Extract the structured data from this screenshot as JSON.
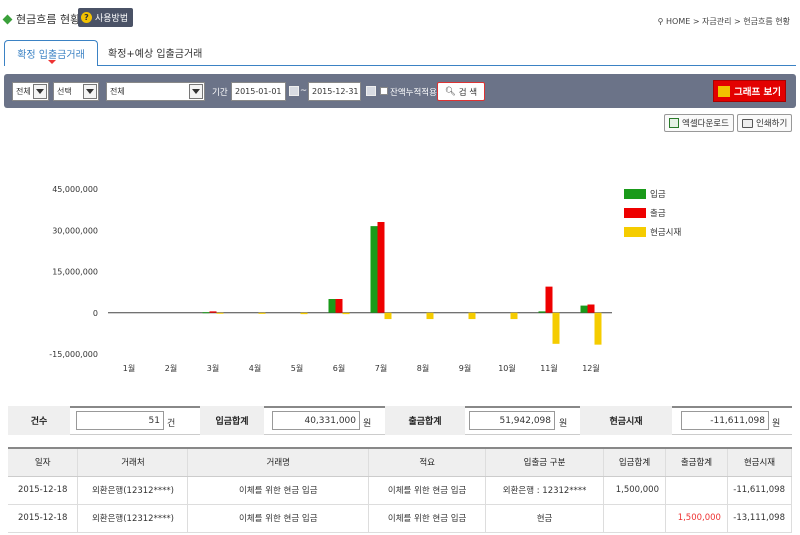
{
  "header": {
    "title": "현금흐름 현황",
    "help_label": "사용방법",
    "breadcrumb": "HOME > 자금관리 > 현금흐름 현황"
  },
  "tabs": [
    {
      "label": "확정 입출금거래"
    },
    {
      "label": "확정+예상 입출금거래"
    }
  ],
  "filters": {
    "sel1": "전체",
    "sel2": "선택",
    "sel3": "전체",
    "period_label": "기간",
    "date_from": "2015-01-01",
    "tilde": "~",
    "date_to": "2015-12-31",
    "cumulative_label": "잔액누적적용",
    "search_label": "검 색",
    "graph_label": "그래프 보기"
  },
  "toolbar": {
    "excel_label": "엑셀다운로드",
    "print_label": "인쇄하기"
  },
  "chart_data": {
    "type": "bar",
    "categories": [
      "1월",
      "2월",
      "3월",
      "4월",
      "5월",
      "6월",
      "7월",
      "8월",
      "9월",
      "10월",
      "11월",
      "12월"
    ],
    "series": [
      {
        "name": "입금",
        "color": "#1a9a1a",
        "values": [
          0,
          0,
          200000,
          0,
          0,
          5000000,
          31500000,
          0,
          0,
          0,
          500000,
          2600000
        ]
      },
      {
        "name": "출금",
        "color": "#ee0000",
        "values": [
          0,
          0,
          500000,
          0,
          0,
          5000000,
          33000000,
          0,
          0,
          0,
          9500000,
          3000000
        ]
      },
      {
        "name": "현금시재",
        "color": "#f5cc00",
        "values": [
          0,
          0,
          -300000,
          -400000,
          -500000,
          -500000,
          -2300000,
          -2300000,
          -2300000,
          -2300000,
          -11300000,
          -11600000
        ]
      }
    ],
    "yticks": [
      "45,000,000",
      "30,000,000",
      "15,000,000",
      "0",
      "-15,000,000"
    ],
    "ylim": [
      -15000000,
      45000000
    ],
    "legend": "right"
  },
  "summary": {
    "count_label": "건수",
    "count_value": "51",
    "count_unit": "건",
    "in_label": "입금합계",
    "in_value": "40,331,000",
    "in_unit": "원",
    "out_label": "출금합계",
    "out_value": "51,942,098",
    "out_unit": "원",
    "cash_label": "현금시재",
    "cash_value": "-11,611,098",
    "cash_unit": "원"
  },
  "table": {
    "headers": [
      "일자",
      "거래처",
      "거래명",
      "적요",
      "입출금 구분",
      "입금합계",
      "출금합계",
      "현금시재"
    ],
    "rows": [
      [
        "2015-12-18",
        "외환은행(12312****)",
        "이체를 위한 현금 입금",
        "이체를 위한 현금 입금",
        "외환은행 : 12312****",
        "1,500,000",
        "",
        "-11,611,098"
      ],
      [
        "2015-12-18",
        "외환은행(12312****)",
        "이체를 위한 현금 입금",
        "이체를 위한 현금 입금",
        "현금",
        "",
        "1,500,000",
        "-13,111,098"
      ]
    ]
  }
}
